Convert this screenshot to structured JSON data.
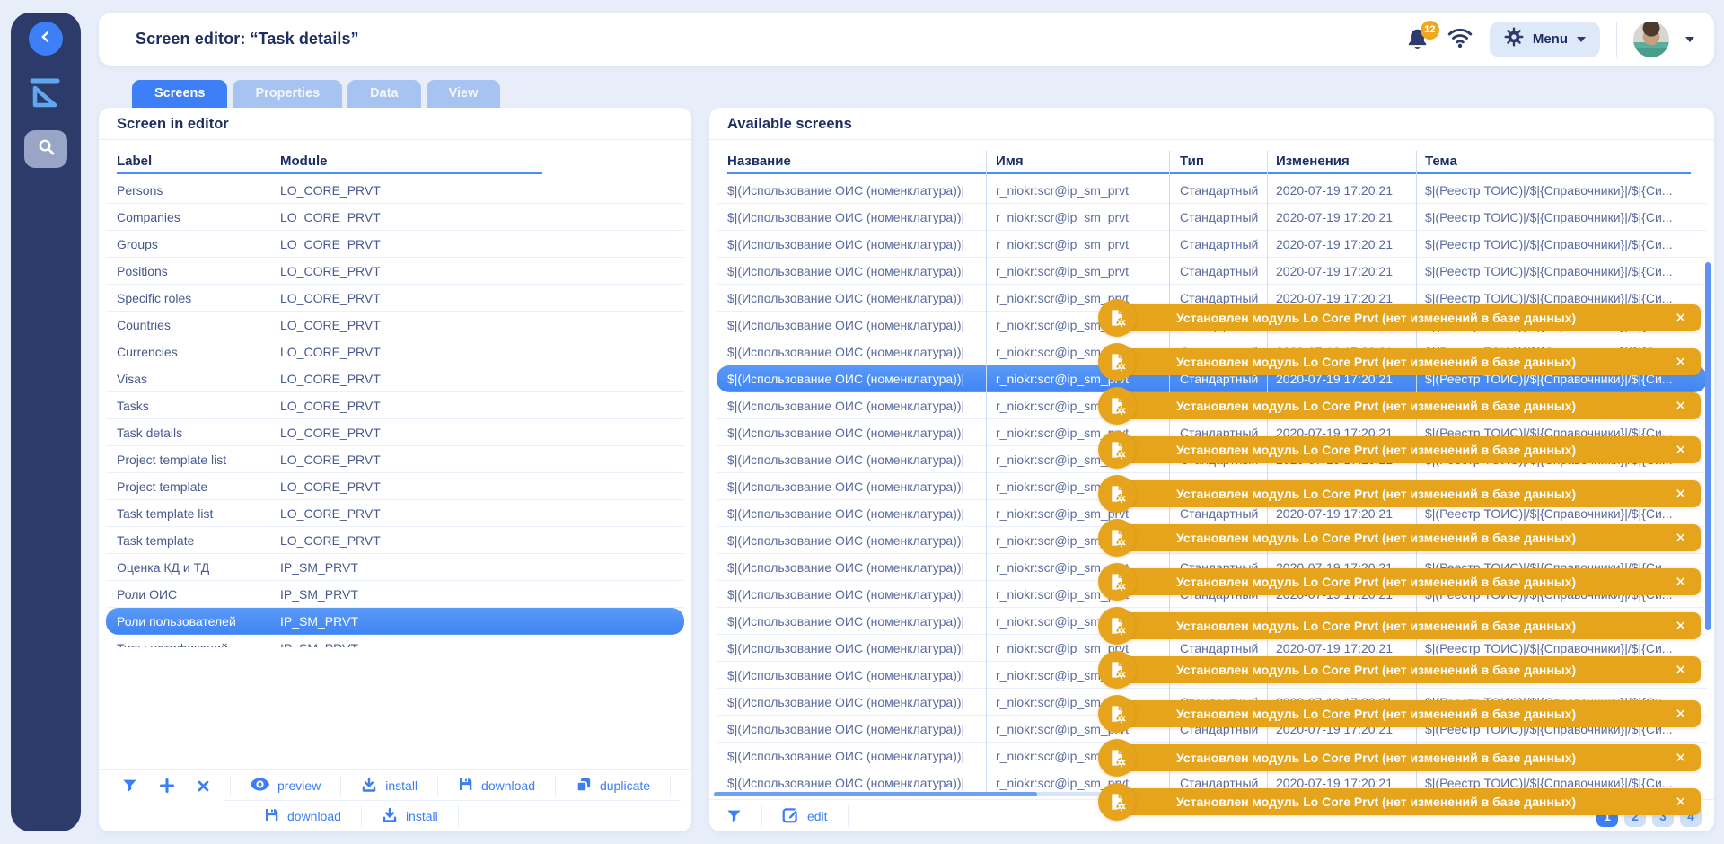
{
  "header": {
    "title": "Screen editor: “Task details”",
    "notification_count": "12",
    "menu_label": "Menu"
  },
  "tabs": [
    {
      "label": "Screens",
      "active": true
    },
    {
      "label": "Properties",
      "active": false
    },
    {
      "label": "Data",
      "active": false
    },
    {
      "label": "View",
      "active": false
    }
  ],
  "editor_panel": {
    "title": "Screen in editor",
    "columns": [
      "Label",
      "Module"
    ],
    "selected_index": 16,
    "rows": [
      {
        "label": "Persons",
        "module": "LO_CORE_PRVT"
      },
      {
        "label": "Companies",
        "module": "LO_CORE_PRVT"
      },
      {
        "label": "Groups",
        "module": "LO_CORE_PRVT"
      },
      {
        "label": "Positions",
        "module": "LO_CORE_PRVT"
      },
      {
        "label": "Specific roles",
        "module": "LO_CORE_PRVT"
      },
      {
        "label": "Countries",
        "module": "LO_CORE_PRVT"
      },
      {
        "label": "Currencies",
        "module": "LO_CORE_PRVT"
      },
      {
        "label": "Visas",
        "module": "LO_CORE_PRVT"
      },
      {
        "label": "Tasks",
        "module": "LO_CORE_PRVT"
      },
      {
        "label": "Task details",
        "module": "LO_CORE_PRVT"
      },
      {
        "label": "Project template list",
        "module": "LO_CORE_PRVT"
      },
      {
        "label": "Project template",
        "module": "LO_CORE_PRVT"
      },
      {
        "label": "Task template list",
        "module": "LO_CORE_PRVT"
      },
      {
        "label": "Task template",
        "module": "LO_CORE_PRVT"
      },
      {
        "label": "Оценка КД и ТД",
        "module": "IP_SM_PRVT"
      },
      {
        "label": "Роли ОИС",
        "module": "IP_SM_PRVT"
      },
      {
        "label": "Роли пользователей",
        "module": "IP_SM_PRVT"
      },
      {
        "label": "Типы нотификаций",
        "module": "IP_SM_PRVT"
      }
    ],
    "toolbar_icons": [
      {
        "icon": "filter"
      },
      {
        "icon": "add"
      },
      {
        "icon": "close"
      }
    ],
    "toolbar_row1": [
      {
        "icon": "eye",
        "label": "preview"
      },
      {
        "icon": "install",
        "label": "install"
      },
      {
        "icon": "save",
        "label": "download"
      },
      {
        "icon": "duplicate",
        "label": "duplicate"
      }
    ],
    "toolbar_row2": [
      {
        "icon": "save",
        "label": "download"
      },
      {
        "icon": "install",
        "label": "install"
      }
    ]
  },
  "available_panel": {
    "title": "Available screens",
    "columns": [
      "Название",
      "Имя",
      "Тип",
      "Изменения",
      "Тема"
    ],
    "selected_index": 7,
    "row_count": 24,
    "row": {
      "name": "$|(Использование ОИС (номенклатура))|",
      "code": "r_niokr:scr@ip_sm_prvt",
      "type": "Стандартный",
      "changed": "2020-07-19 17:20:21",
      "theme": "$|(Реестр ТОИС)|/$|{Справочники}|/$|{Си..."
    },
    "toolbar_icons": [
      {
        "icon": "filter"
      }
    ],
    "toolbar_buttons": [
      {
        "icon": "edit",
        "label": "edit"
      }
    ],
    "pagination": {
      "pages": [
        "1",
        "2",
        "3",
        "4"
      ],
      "active_page": "1"
    }
  },
  "toasts": {
    "count": 12,
    "message": "Установлен модуль Lo Core Prvt (нет изменений в базе данных)",
    "icon": "module-document-gear",
    "close_icon": "✕"
  },
  "colors": {
    "accent": "#3c7ef4",
    "selection": "#4a8ef5",
    "toast": "#e6a41c",
    "sidebar": "#2d3b6b",
    "badge": "#efa81e",
    "tab_inactive": "#a6c3f2"
  }
}
